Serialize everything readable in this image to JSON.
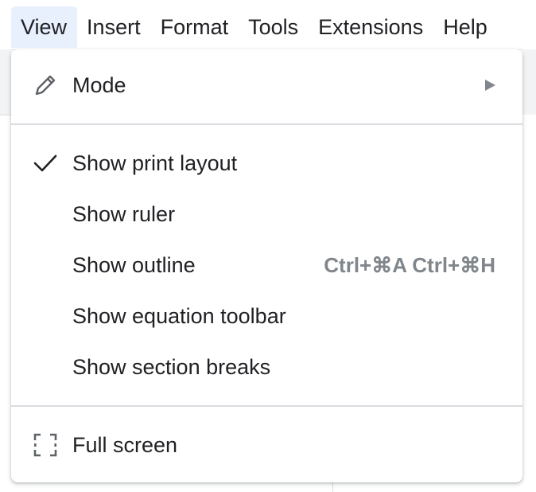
{
  "menubar": {
    "items": [
      {
        "label": "View",
        "active": true
      },
      {
        "label": "Insert",
        "active": false
      },
      {
        "label": "Format",
        "active": false
      },
      {
        "label": "Tools",
        "active": false
      },
      {
        "label": "Extensions",
        "active": false
      },
      {
        "label": "Help",
        "active": false
      }
    ]
  },
  "view_menu": {
    "mode": {
      "label": "Mode",
      "icon": "pencil-icon",
      "has_submenu": true
    },
    "show_print_layout": {
      "label": "Show print layout",
      "checked": true,
      "icon": "checkmark-icon"
    },
    "show_ruler": {
      "label": "Show ruler",
      "checked": false
    },
    "show_outline": {
      "label": "Show outline",
      "checked": false,
      "shortcut": "Ctrl+⌘A Ctrl+⌘H"
    },
    "show_equation_toolbar": {
      "label": "Show equation toolbar",
      "checked": false
    },
    "show_section_breaks": {
      "label": "Show section breaks",
      "checked": false
    },
    "full_screen": {
      "label": "Full screen",
      "icon": "fullscreen-icon"
    }
  },
  "colors": {
    "text": "#202124",
    "secondary_text": "#80868b",
    "active_menu_bg": "#e8f0fe",
    "divider": "#dadce0"
  }
}
